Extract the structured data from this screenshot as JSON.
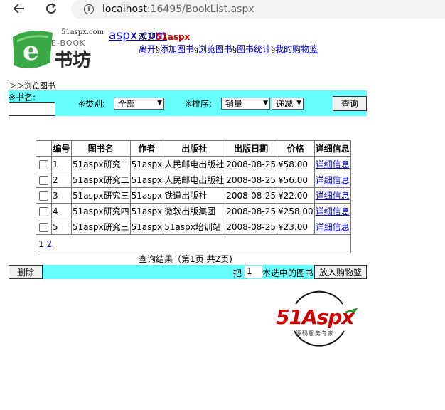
{
  "browser": {
    "url_host": "localhost",
    "url_rest": ":16495/BookList.aspx"
  },
  "header": {
    "logo_domain": "51aspx.com",
    "logo_ebook": "E-BOOK",
    "logo_name": "书坊",
    "site_link": "aspx.com",
    "welcome_prefix": "欢迎",
    "welcome_user": "51aspx",
    "nav": [
      {
        "label": "离开"
      },
      {
        "label": "添加图书"
      },
      {
        "label": "浏览图书"
      },
      {
        "label": "图书统计"
      },
      {
        "label": "我的购物篮"
      }
    ],
    "nav_sep": "§"
  },
  "breadcrumb": "＞＞浏览图书",
  "search": {
    "name_label": "※书名:",
    "name_value": "",
    "category_label": "※类别:",
    "category_value": "全部",
    "sort_label": "※排序:",
    "sort_value": "销量",
    "order_value": "递减",
    "submit_label": "查询"
  },
  "table": {
    "headers": [
      "",
      "编号",
      "图书名",
      "作者",
      "出版社",
      "出版日期",
      "价格",
      "详细信息"
    ],
    "rows": [
      {
        "id": "1",
        "title": "51aspx研究一",
        "author": "51aspx",
        "publisher": "人民邮电出版社",
        "date": "2008-08-25",
        "price": "¥58.00",
        "detail": "详细信息"
      },
      {
        "id": "2",
        "title": "51aspx研究二",
        "author": "51aspx",
        "publisher": "人民邮电出版社",
        "date": "2008-08-25",
        "price": "¥56.00",
        "detail": "详细信息"
      },
      {
        "id": "3",
        "title": "51aspx研究三",
        "author": "51aspx",
        "publisher": "铁道出版社",
        "date": "2008-08-25",
        "price": "¥22.00",
        "detail": "详细信息"
      },
      {
        "id": "4",
        "title": "51aspx研究四",
        "author": "51aspx",
        "publisher": "微软出版集团",
        "date": "2008-08-25",
        "price": "¥258.00",
        "detail": "详细信息"
      },
      {
        "id": "5",
        "title": "51aspx研究三",
        "author": "51aspx",
        "publisher": "51aspx培训站",
        "date": "2008-08-25",
        "price": "¥23.00",
        "detail": "详细信息"
      }
    ],
    "pager_current": "1",
    "pager_next": "2"
  },
  "result_text": "查询结果（第1页 共2页)",
  "bottom": {
    "delete_label": "删除",
    "prefix": "把",
    "qty_value": "1",
    "suffix": "本选中的图书",
    "add_cart_label": "放入购物篮"
  },
  "watermark": {
    "brand": "51Aspx",
    "tagline": "源码服务专家"
  },
  "colors": {
    "bar_bg": "#66ffff",
    "link": "#0000cc",
    "brand_red": "#cc0000",
    "brand_green": "#2e8b2e"
  }
}
